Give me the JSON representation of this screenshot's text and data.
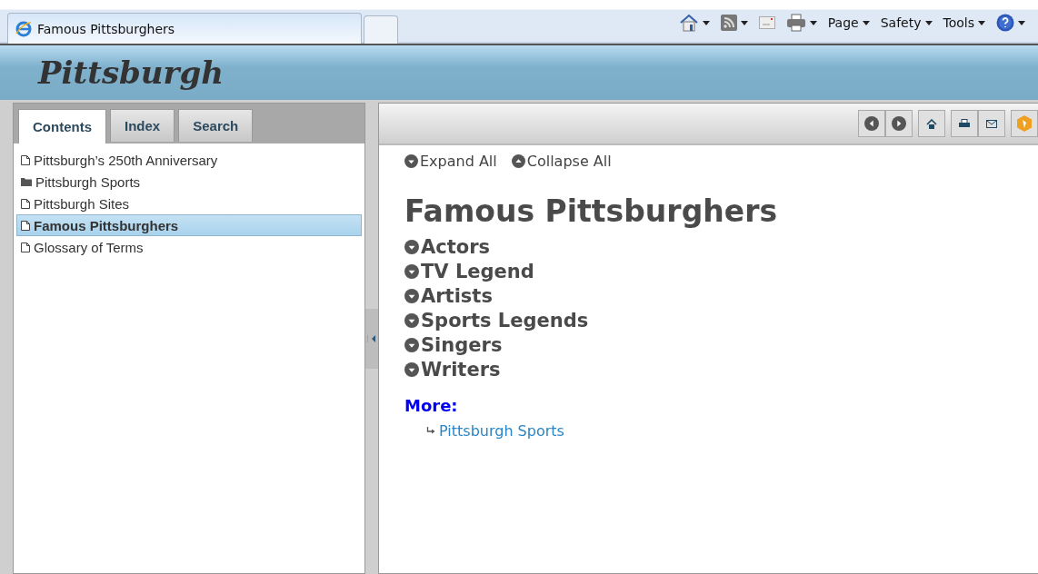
{
  "browser": {
    "tab_title": "Famous Pittsburghers",
    "commands": [
      {
        "kind": "home"
      },
      {
        "kind": "feed"
      },
      {
        "kind": "mail"
      },
      {
        "kind": "print"
      },
      {
        "kind": "menu",
        "label": "Page"
      },
      {
        "kind": "menu",
        "label": "Safety"
      },
      {
        "kind": "menu",
        "label": "Tools"
      },
      {
        "kind": "help"
      }
    ]
  },
  "header": {
    "title": "Pittsburgh"
  },
  "sidebar": {
    "tabs": [
      {
        "label": "Contents",
        "selected": true
      },
      {
        "label": "Index",
        "selected": false
      },
      {
        "label": "Search",
        "selected": false
      }
    ],
    "items": [
      {
        "label": "Pittsburgh’s 250th Anniversary",
        "kind": "page",
        "selected": false
      },
      {
        "label": "Pittsburgh Sports",
        "kind": "folder",
        "selected": false
      },
      {
        "label": "Pittsburgh Sites",
        "kind": "page",
        "selected": false
      },
      {
        "label": "Famous Pittsburghers",
        "kind": "page",
        "selected": true
      },
      {
        "label": "Glossary of Terms",
        "kind": "page",
        "selected": false
      }
    ]
  },
  "toolbar": {
    "buttons": [
      {
        "kind": "back"
      },
      {
        "kind": "forward"
      },
      {
        "kind": "home"
      },
      {
        "kind": "print"
      },
      {
        "kind": "email"
      },
      {
        "kind": "highlight"
      }
    ]
  },
  "content": {
    "expand_all": "Expand All",
    "collapse_all": "Collapse All",
    "title": "Famous Pittsburghers",
    "sections": [
      {
        "label": "Actors",
        "expanded": false
      },
      {
        "label": "TV Legend",
        "expanded": false
      },
      {
        "label": "Artists",
        "expanded": false
      },
      {
        "label": "Sports Legends",
        "expanded": false
      },
      {
        "label": "Singers",
        "expanded": false
      },
      {
        "label": "Writers",
        "expanded": false
      }
    ],
    "more_heading": "More:",
    "links": [
      "Pittsburgh Sports"
    ]
  }
}
